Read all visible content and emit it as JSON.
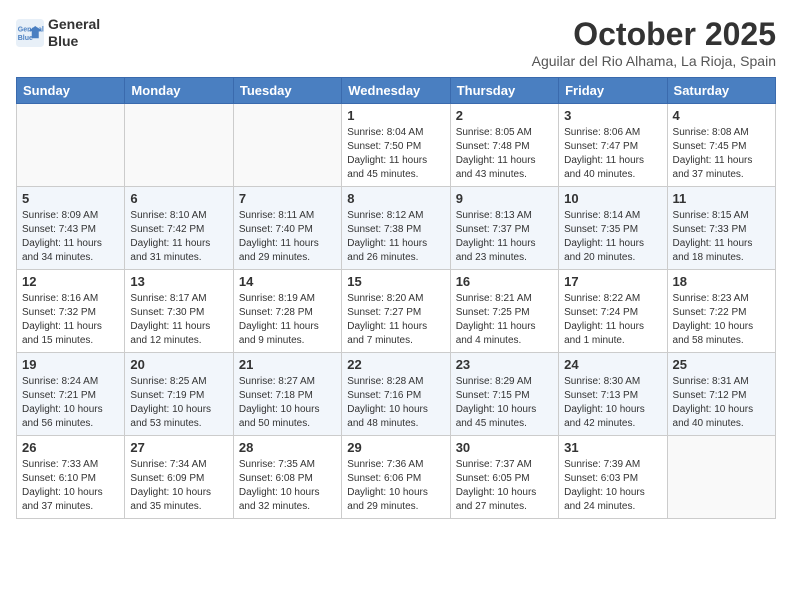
{
  "logo": {
    "line1": "General",
    "line2": "Blue"
  },
  "title": "October 2025",
  "location": "Aguilar del Rio Alhama, La Rioja, Spain",
  "days_of_week": [
    "Sunday",
    "Monday",
    "Tuesday",
    "Wednesday",
    "Thursday",
    "Friday",
    "Saturday"
  ],
  "weeks": [
    [
      {
        "day": "",
        "detail": ""
      },
      {
        "day": "",
        "detail": ""
      },
      {
        "day": "",
        "detail": ""
      },
      {
        "day": "1",
        "detail": "Sunrise: 8:04 AM\nSunset: 7:50 PM\nDaylight: 11 hours\nand 45 minutes."
      },
      {
        "day": "2",
        "detail": "Sunrise: 8:05 AM\nSunset: 7:48 PM\nDaylight: 11 hours\nand 43 minutes."
      },
      {
        "day": "3",
        "detail": "Sunrise: 8:06 AM\nSunset: 7:47 PM\nDaylight: 11 hours\nand 40 minutes."
      },
      {
        "day": "4",
        "detail": "Sunrise: 8:08 AM\nSunset: 7:45 PM\nDaylight: 11 hours\nand 37 minutes."
      }
    ],
    [
      {
        "day": "5",
        "detail": "Sunrise: 8:09 AM\nSunset: 7:43 PM\nDaylight: 11 hours\nand 34 minutes."
      },
      {
        "day": "6",
        "detail": "Sunrise: 8:10 AM\nSunset: 7:42 PM\nDaylight: 11 hours\nand 31 minutes."
      },
      {
        "day": "7",
        "detail": "Sunrise: 8:11 AM\nSunset: 7:40 PM\nDaylight: 11 hours\nand 29 minutes."
      },
      {
        "day": "8",
        "detail": "Sunrise: 8:12 AM\nSunset: 7:38 PM\nDaylight: 11 hours\nand 26 minutes."
      },
      {
        "day": "9",
        "detail": "Sunrise: 8:13 AM\nSunset: 7:37 PM\nDaylight: 11 hours\nand 23 minutes."
      },
      {
        "day": "10",
        "detail": "Sunrise: 8:14 AM\nSunset: 7:35 PM\nDaylight: 11 hours\nand 20 minutes."
      },
      {
        "day": "11",
        "detail": "Sunrise: 8:15 AM\nSunset: 7:33 PM\nDaylight: 11 hours\nand 18 minutes."
      }
    ],
    [
      {
        "day": "12",
        "detail": "Sunrise: 8:16 AM\nSunset: 7:32 PM\nDaylight: 11 hours\nand 15 minutes."
      },
      {
        "day": "13",
        "detail": "Sunrise: 8:17 AM\nSunset: 7:30 PM\nDaylight: 11 hours\nand 12 minutes."
      },
      {
        "day": "14",
        "detail": "Sunrise: 8:19 AM\nSunset: 7:28 PM\nDaylight: 11 hours\nand 9 minutes."
      },
      {
        "day": "15",
        "detail": "Sunrise: 8:20 AM\nSunset: 7:27 PM\nDaylight: 11 hours\nand 7 minutes."
      },
      {
        "day": "16",
        "detail": "Sunrise: 8:21 AM\nSunset: 7:25 PM\nDaylight: 11 hours\nand 4 minutes."
      },
      {
        "day": "17",
        "detail": "Sunrise: 8:22 AM\nSunset: 7:24 PM\nDaylight: 11 hours\nand 1 minute."
      },
      {
        "day": "18",
        "detail": "Sunrise: 8:23 AM\nSunset: 7:22 PM\nDaylight: 10 hours\nand 58 minutes."
      }
    ],
    [
      {
        "day": "19",
        "detail": "Sunrise: 8:24 AM\nSunset: 7:21 PM\nDaylight: 10 hours\nand 56 minutes."
      },
      {
        "day": "20",
        "detail": "Sunrise: 8:25 AM\nSunset: 7:19 PM\nDaylight: 10 hours\nand 53 minutes."
      },
      {
        "day": "21",
        "detail": "Sunrise: 8:27 AM\nSunset: 7:18 PM\nDaylight: 10 hours\nand 50 minutes."
      },
      {
        "day": "22",
        "detail": "Sunrise: 8:28 AM\nSunset: 7:16 PM\nDaylight: 10 hours\nand 48 minutes."
      },
      {
        "day": "23",
        "detail": "Sunrise: 8:29 AM\nSunset: 7:15 PM\nDaylight: 10 hours\nand 45 minutes."
      },
      {
        "day": "24",
        "detail": "Sunrise: 8:30 AM\nSunset: 7:13 PM\nDaylight: 10 hours\nand 42 minutes."
      },
      {
        "day": "25",
        "detail": "Sunrise: 8:31 AM\nSunset: 7:12 PM\nDaylight: 10 hours\nand 40 minutes."
      }
    ],
    [
      {
        "day": "26",
        "detail": "Sunrise: 7:33 AM\nSunset: 6:10 PM\nDaylight: 10 hours\nand 37 minutes."
      },
      {
        "day": "27",
        "detail": "Sunrise: 7:34 AM\nSunset: 6:09 PM\nDaylight: 10 hours\nand 35 minutes."
      },
      {
        "day": "28",
        "detail": "Sunrise: 7:35 AM\nSunset: 6:08 PM\nDaylight: 10 hours\nand 32 minutes."
      },
      {
        "day": "29",
        "detail": "Sunrise: 7:36 AM\nSunset: 6:06 PM\nDaylight: 10 hours\nand 29 minutes."
      },
      {
        "day": "30",
        "detail": "Sunrise: 7:37 AM\nSunset: 6:05 PM\nDaylight: 10 hours\nand 27 minutes."
      },
      {
        "day": "31",
        "detail": "Sunrise: 7:39 AM\nSunset: 6:03 PM\nDaylight: 10 hours\nand 24 minutes."
      },
      {
        "day": "",
        "detail": ""
      }
    ]
  ]
}
